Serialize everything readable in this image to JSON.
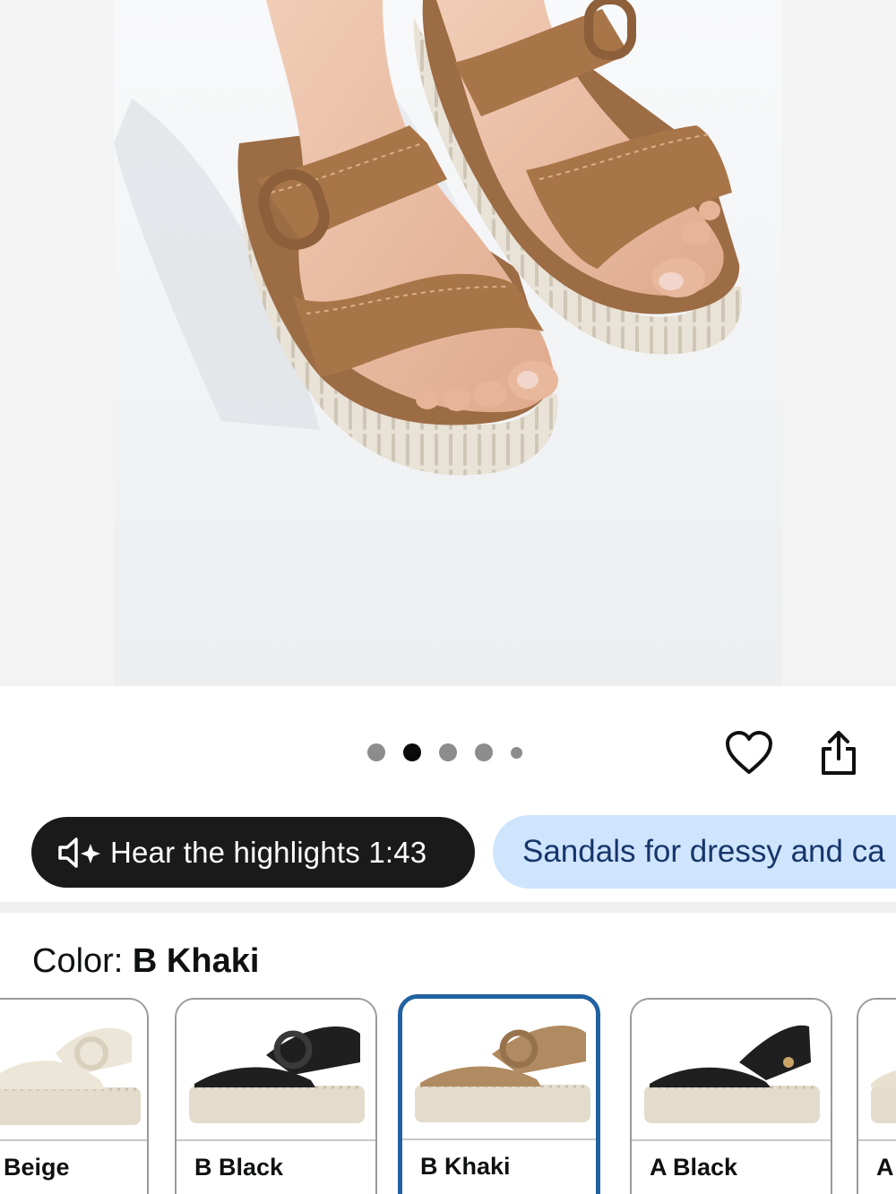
{
  "gallery": {
    "page_count": 5,
    "active_index": 1
  },
  "actions": {
    "favorite_icon": "heart-icon",
    "share_icon": "share-icon"
  },
  "highlights": {
    "label": "Hear the highlights 1:43",
    "icon": "speaker-sparkle-icon"
  },
  "review_chip": {
    "label": "Sandals for dressy and ca"
  },
  "color": {
    "prefix": "Color: ",
    "selected": "B Khaki"
  },
  "swatches": [
    {
      "name": "Beige",
      "sub": "·· ··"
    },
    {
      "name": "B Black",
      "sub": "·· ··"
    },
    {
      "name": "B Khaki",
      "sub": "·· ··"
    },
    {
      "name": "A Black",
      "sub": "·· ··"
    },
    {
      "name": "A",
      "sub": "·"
    }
  ],
  "colors": {
    "selected_border": "#2162a1",
    "dark_pill": "#1a1a1a",
    "blue_pill": "#cfe4fd",
    "khaki": "#a87549"
  }
}
